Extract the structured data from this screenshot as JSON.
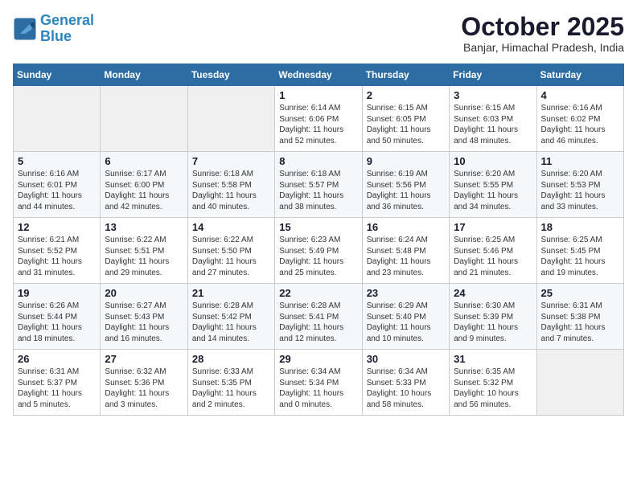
{
  "logo": {
    "line1": "General",
    "line2": "Blue"
  },
  "title": "October 2025",
  "subtitle": "Banjar, Himachal Pradesh, India",
  "weekdays": [
    "Sunday",
    "Monday",
    "Tuesday",
    "Wednesday",
    "Thursday",
    "Friday",
    "Saturday"
  ],
  "weeks": [
    [
      {
        "day": "",
        "info": ""
      },
      {
        "day": "",
        "info": ""
      },
      {
        "day": "",
        "info": ""
      },
      {
        "day": "1",
        "info": "Sunrise: 6:14 AM\nSunset: 6:06 PM\nDaylight: 11 hours\nand 52 minutes."
      },
      {
        "day": "2",
        "info": "Sunrise: 6:15 AM\nSunset: 6:05 PM\nDaylight: 11 hours\nand 50 minutes."
      },
      {
        "day": "3",
        "info": "Sunrise: 6:15 AM\nSunset: 6:03 PM\nDaylight: 11 hours\nand 48 minutes."
      },
      {
        "day": "4",
        "info": "Sunrise: 6:16 AM\nSunset: 6:02 PM\nDaylight: 11 hours\nand 46 minutes."
      }
    ],
    [
      {
        "day": "5",
        "info": "Sunrise: 6:16 AM\nSunset: 6:01 PM\nDaylight: 11 hours\nand 44 minutes."
      },
      {
        "day": "6",
        "info": "Sunrise: 6:17 AM\nSunset: 6:00 PM\nDaylight: 11 hours\nand 42 minutes."
      },
      {
        "day": "7",
        "info": "Sunrise: 6:18 AM\nSunset: 5:58 PM\nDaylight: 11 hours\nand 40 minutes."
      },
      {
        "day": "8",
        "info": "Sunrise: 6:18 AM\nSunset: 5:57 PM\nDaylight: 11 hours\nand 38 minutes."
      },
      {
        "day": "9",
        "info": "Sunrise: 6:19 AM\nSunset: 5:56 PM\nDaylight: 11 hours\nand 36 minutes."
      },
      {
        "day": "10",
        "info": "Sunrise: 6:20 AM\nSunset: 5:55 PM\nDaylight: 11 hours\nand 34 minutes."
      },
      {
        "day": "11",
        "info": "Sunrise: 6:20 AM\nSunset: 5:53 PM\nDaylight: 11 hours\nand 33 minutes."
      }
    ],
    [
      {
        "day": "12",
        "info": "Sunrise: 6:21 AM\nSunset: 5:52 PM\nDaylight: 11 hours\nand 31 minutes."
      },
      {
        "day": "13",
        "info": "Sunrise: 6:22 AM\nSunset: 5:51 PM\nDaylight: 11 hours\nand 29 minutes."
      },
      {
        "day": "14",
        "info": "Sunrise: 6:22 AM\nSunset: 5:50 PM\nDaylight: 11 hours\nand 27 minutes."
      },
      {
        "day": "15",
        "info": "Sunrise: 6:23 AM\nSunset: 5:49 PM\nDaylight: 11 hours\nand 25 minutes."
      },
      {
        "day": "16",
        "info": "Sunrise: 6:24 AM\nSunset: 5:48 PM\nDaylight: 11 hours\nand 23 minutes."
      },
      {
        "day": "17",
        "info": "Sunrise: 6:25 AM\nSunset: 5:46 PM\nDaylight: 11 hours\nand 21 minutes."
      },
      {
        "day": "18",
        "info": "Sunrise: 6:25 AM\nSunset: 5:45 PM\nDaylight: 11 hours\nand 19 minutes."
      }
    ],
    [
      {
        "day": "19",
        "info": "Sunrise: 6:26 AM\nSunset: 5:44 PM\nDaylight: 11 hours\nand 18 minutes."
      },
      {
        "day": "20",
        "info": "Sunrise: 6:27 AM\nSunset: 5:43 PM\nDaylight: 11 hours\nand 16 minutes."
      },
      {
        "day": "21",
        "info": "Sunrise: 6:28 AM\nSunset: 5:42 PM\nDaylight: 11 hours\nand 14 minutes."
      },
      {
        "day": "22",
        "info": "Sunrise: 6:28 AM\nSunset: 5:41 PM\nDaylight: 11 hours\nand 12 minutes."
      },
      {
        "day": "23",
        "info": "Sunrise: 6:29 AM\nSunset: 5:40 PM\nDaylight: 11 hours\nand 10 minutes."
      },
      {
        "day": "24",
        "info": "Sunrise: 6:30 AM\nSunset: 5:39 PM\nDaylight: 11 hours\nand 9 minutes."
      },
      {
        "day": "25",
        "info": "Sunrise: 6:31 AM\nSunset: 5:38 PM\nDaylight: 11 hours\nand 7 minutes."
      }
    ],
    [
      {
        "day": "26",
        "info": "Sunrise: 6:31 AM\nSunset: 5:37 PM\nDaylight: 11 hours\nand 5 minutes."
      },
      {
        "day": "27",
        "info": "Sunrise: 6:32 AM\nSunset: 5:36 PM\nDaylight: 11 hours\nand 3 minutes."
      },
      {
        "day": "28",
        "info": "Sunrise: 6:33 AM\nSunset: 5:35 PM\nDaylight: 11 hours\nand 2 minutes."
      },
      {
        "day": "29",
        "info": "Sunrise: 6:34 AM\nSunset: 5:34 PM\nDaylight: 11 hours\nand 0 minutes."
      },
      {
        "day": "30",
        "info": "Sunrise: 6:34 AM\nSunset: 5:33 PM\nDaylight: 10 hours\nand 58 minutes."
      },
      {
        "day": "31",
        "info": "Sunrise: 6:35 AM\nSunset: 5:32 PM\nDaylight: 10 hours\nand 56 minutes."
      },
      {
        "day": "",
        "info": ""
      }
    ]
  ]
}
